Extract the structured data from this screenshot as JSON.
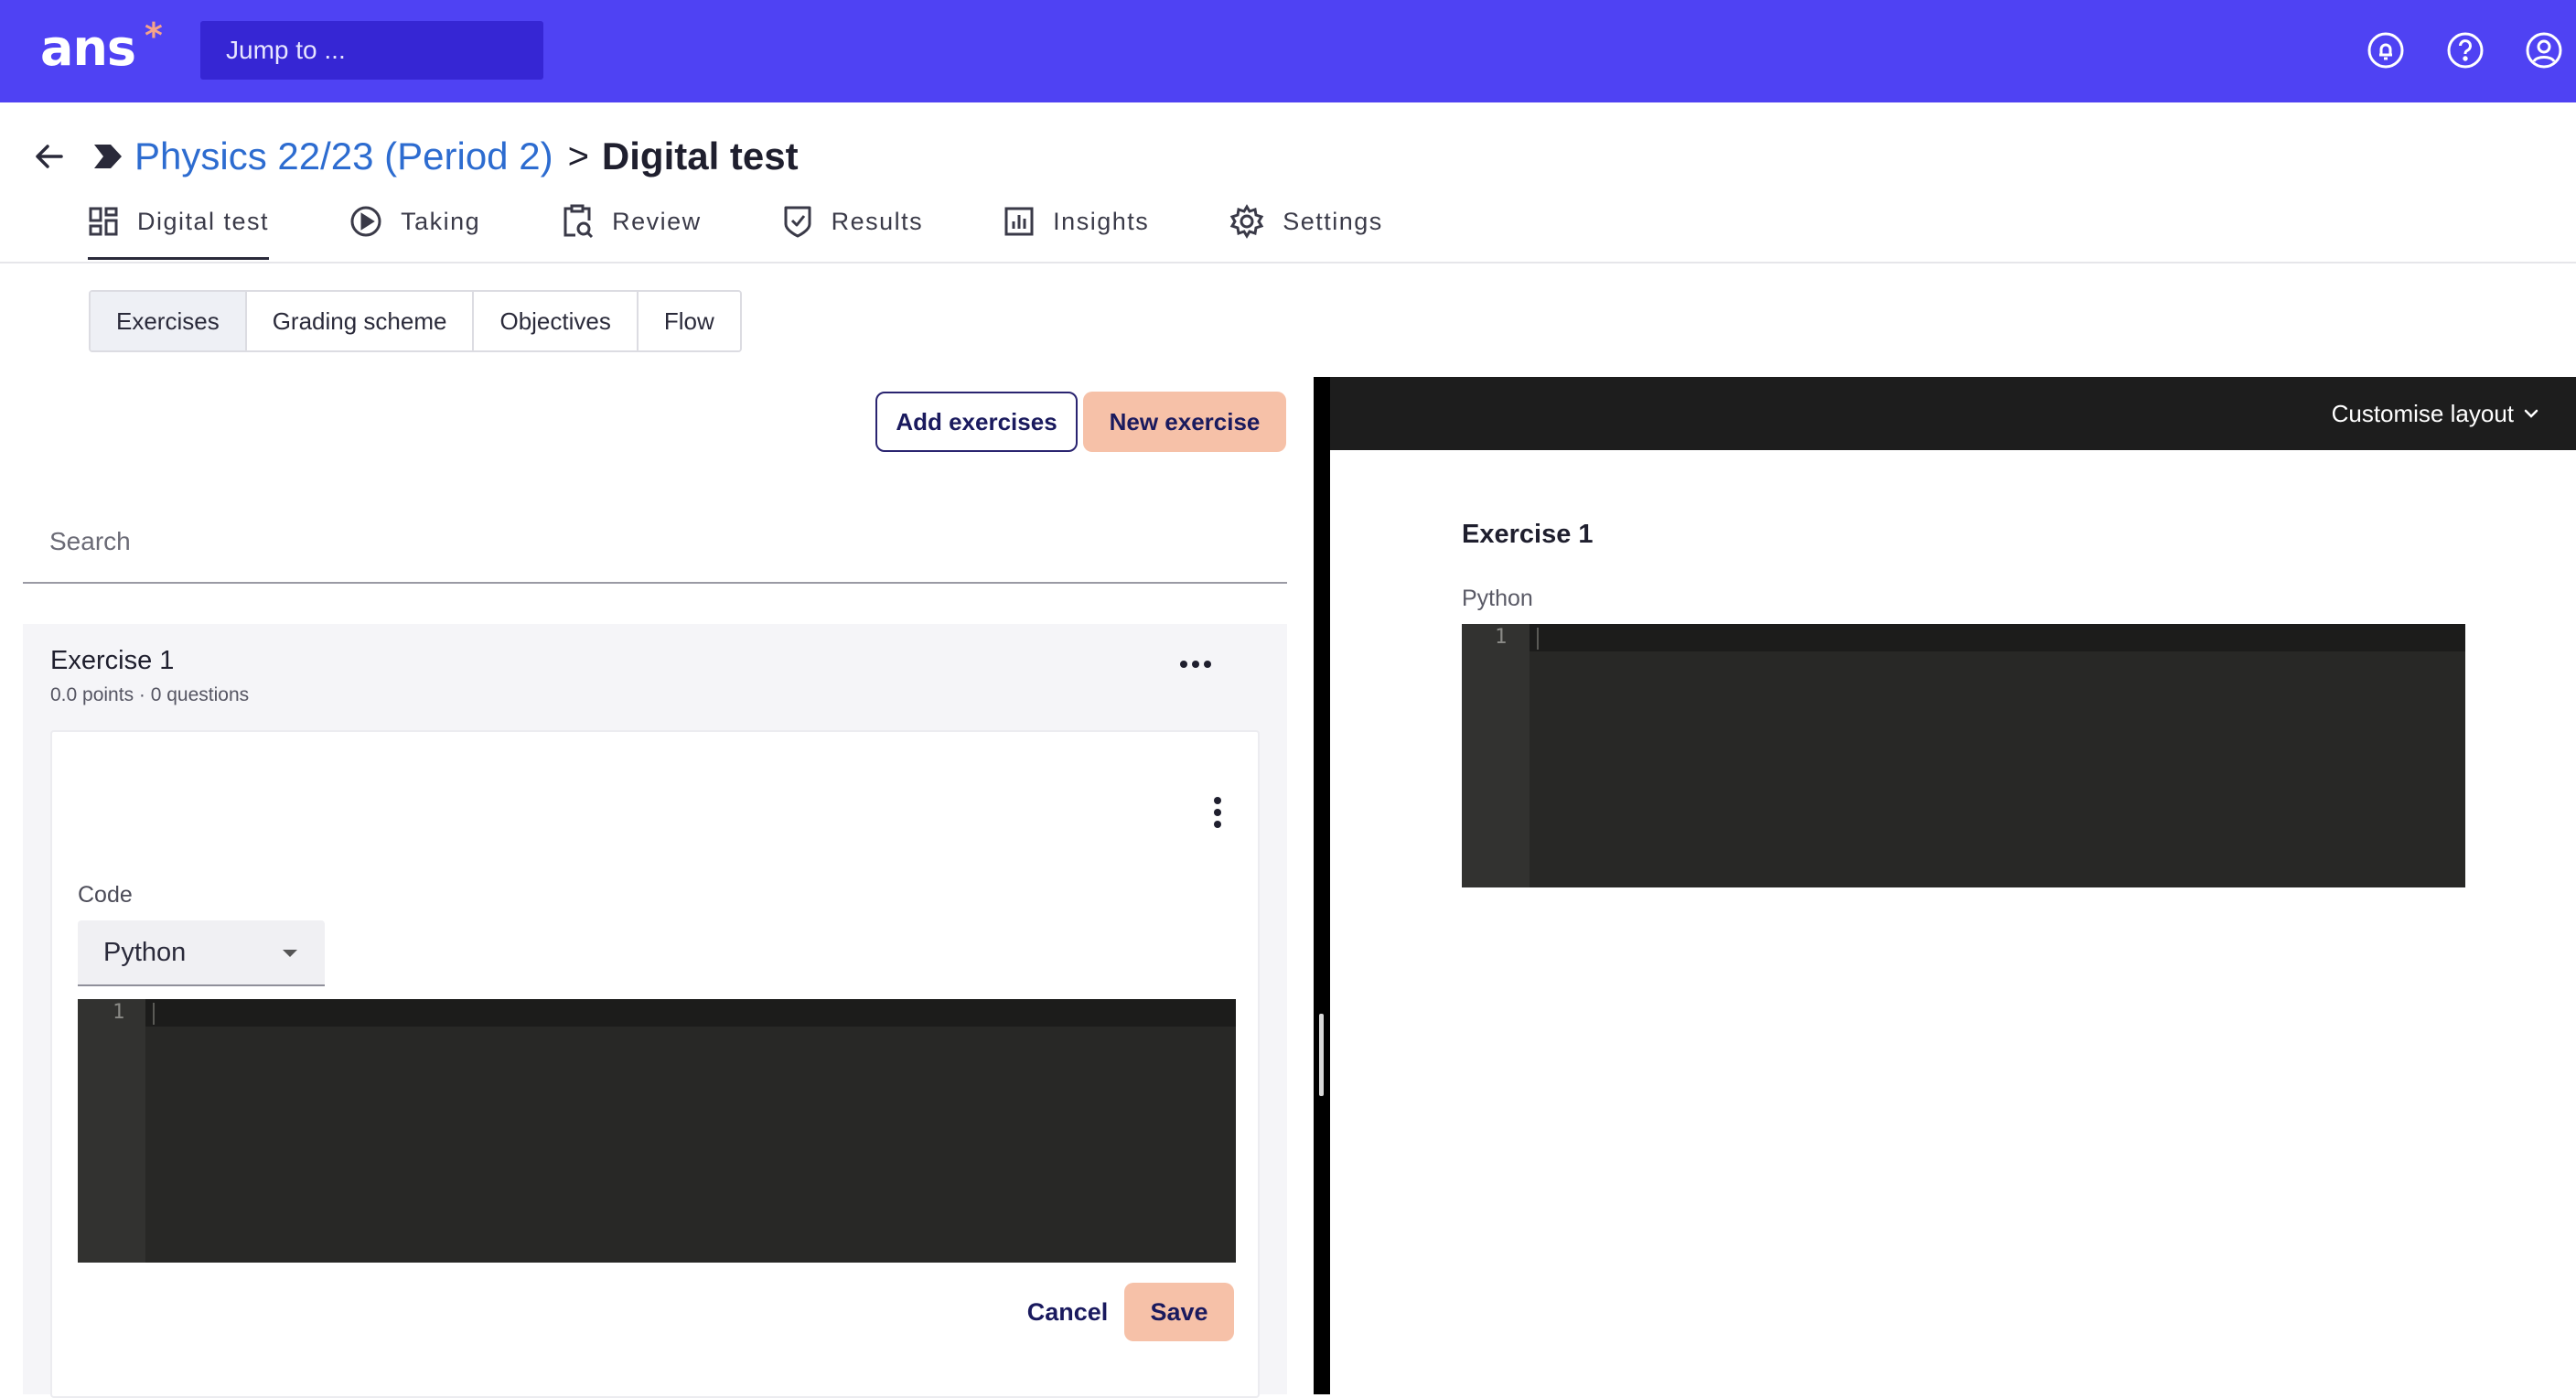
{
  "app": {
    "logo_text": "ans",
    "logo_mark": "*",
    "jump_placeholder": "Jump to ...",
    "top_icons": [
      "notification-icon",
      "help-icon",
      "account-icon"
    ]
  },
  "header": {
    "course": "Physics 22/23 (Period 2)",
    "separator": ">",
    "page_title": "Digital test"
  },
  "tabs": [
    {
      "label": "Digital test",
      "icon": "grid-icon",
      "active": true
    },
    {
      "label": "Taking",
      "icon": "play-circle-icon",
      "active": false
    },
    {
      "label": "Review",
      "icon": "clipboard-search-icon",
      "active": false
    },
    {
      "label": "Results",
      "icon": "shield-check-icon",
      "active": false
    },
    {
      "label": "Insights",
      "icon": "bar-chart-icon",
      "active": false
    },
    {
      "label": "Settings",
      "icon": "gear-icon",
      "active": false
    }
  ],
  "subtabs": [
    {
      "label": "Exercises",
      "active": true
    },
    {
      "label": "Grading scheme",
      "active": false
    },
    {
      "label": "Objectives",
      "active": false
    },
    {
      "label": "Flow",
      "active": false
    }
  ],
  "actions": {
    "add_exercises": "Add exercises",
    "new_exercise": "New exercise"
  },
  "search": {
    "placeholder": "Search",
    "value": ""
  },
  "exercise": {
    "title": "Exercise 1",
    "meta": "0.0 points · 0 questions",
    "question": {
      "code_label": "Code",
      "language": "Python",
      "line_number": "1",
      "cancel_label": "Cancel",
      "save_label": "Save"
    }
  },
  "preview": {
    "customise_label": "Customise layout",
    "title": "Exercise 1",
    "language": "Python",
    "line_number": "1"
  },
  "colors": {
    "brand": "#4f42f3",
    "brand_dark": "#3626d4",
    "accent_peach": "#f6c1a8",
    "link_blue": "#2d6cd0",
    "editor_bg": "#282826"
  }
}
